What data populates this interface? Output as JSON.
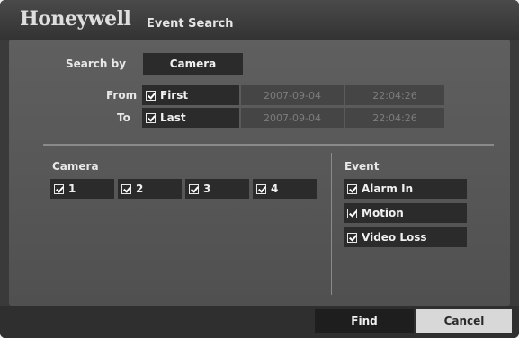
{
  "header": {
    "brand": "Honeywell",
    "title": "Event Search"
  },
  "search": {
    "by_label": "Search by",
    "by_value": "Camera",
    "from_label": "From",
    "to_label": "To",
    "from": {
      "option": "First",
      "date": "2007-09-04",
      "time": "22:04:26"
    },
    "to": {
      "option": "Last",
      "date": "2007-09-04",
      "time": "22:04:26"
    }
  },
  "camera": {
    "heading": "Camera",
    "items": [
      "1",
      "2",
      "3",
      "4"
    ]
  },
  "event": {
    "heading": "Event",
    "items": [
      "Alarm In",
      "Motion",
      "Video Loss"
    ]
  },
  "footer": {
    "find": "Find",
    "cancel": "Cancel"
  }
}
